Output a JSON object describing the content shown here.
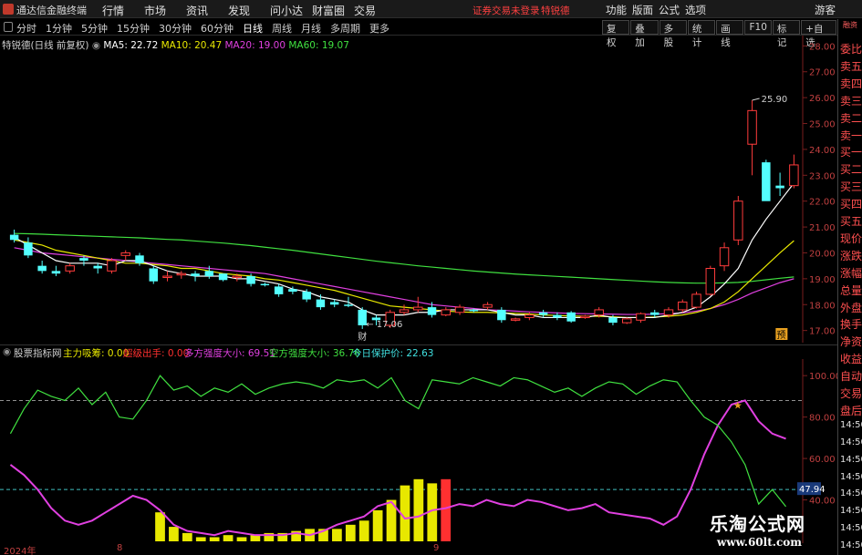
{
  "app": {
    "title": "通达信金融终端",
    "menu": [
      "行情",
      "市场",
      "资讯",
      "发现",
      "问小达",
      "财富圈",
      "交易"
    ],
    "alert": "证券交易未登录",
    "alert_stock": "特锐德",
    "right_menu": [
      "功能",
      "版面",
      "公式",
      "选项"
    ],
    "guest": "游客"
  },
  "toolbar": {
    "periods": [
      "分时",
      "1分钟",
      "5分钟",
      "15分钟",
      "30分钟",
      "60分钟",
      "日线",
      "周线",
      "月线",
      "多周期",
      "更多"
    ],
    "active_period": "日线",
    "right_tools": [
      "复权",
      "叠加",
      "多股",
      "统计",
      "画线",
      "F10",
      "标记",
      "+自选"
    ]
  },
  "chart_header": {
    "stock_name": "特锐德(日线 前复权)",
    "ma5": "MA5: 22.72",
    "ma10": "MA10: 20.47",
    "ma20": "MA20: 19.00",
    "ma60": "MA60: 19.07",
    "ma5_color": "#ffffff",
    "ma10_color": "#e8e800",
    "ma20_color": "#e040e0",
    "ma60_color": "#40e040"
  },
  "indicator_header": {
    "name": "股票指标网",
    "items": [
      {
        "text": "主力吸筹: 0.00",
        "color": "#e8e800"
      },
      {
        "text": "超级出手: 0.00",
        "color": "#ff3030"
      },
      {
        "text": "多方强度大小: 69.51",
        "color": "#e040e0"
      },
      {
        "text": "空方强度大小: 36.76",
        "color": "#40e040"
      },
      {
        "text": "今日保护价: 22.63",
        "color": "#40e0e0"
      }
    ]
  },
  "side_panel": {
    "top_label": "融资",
    "labels": [
      "委比",
      "卖五",
      "卖四",
      "卖三",
      "卖二",
      "卖一",
      "买一",
      "买二",
      "买三",
      "买四",
      "买五",
      "现价",
      "涨跌",
      "涨幅",
      "总量",
      "外盘",
      "换手",
      "净资",
      "收益",
      "自动",
      "交易",
      "盘后",
      "14:50",
      "14:50",
      "14:50",
      "14:50",
      "14:50",
      "14:50",
      "14:50",
      "14:50"
    ]
  },
  "annotations": {
    "high_label": "25.90",
    "low_label": "17.06",
    "low_marker": "财",
    "pre_marker": "预",
    "sub_value_tag": "47.94"
  },
  "x_axis": {
    "labels": [
      "2024年",
      "8",
      "9"
    ]
  },
  "watermark": {
    "line1": "乐淘公式网",
    "line2": "www.60lt.com"
  },
  "chart_data": [
    {
      "type": "candlestick",
      "title": "特锐德(日线 前复权)",
      "ylim": [
        16.6,
        28.4
      ],
      "y_ticks": [
        28.0,
        27.0,
        26.0,
        25.0,
        24.0,
        23.0,
        22.0,
        21.0,
        20.0,
        19.0,
        18.0,
        17.0
      ],
      "candles": [
        {
          "o": 20.7,
          "h": 20.9,
          "l": 20.4,
          "c": 20.5
        },
        {
          "o": 20.4,
          "h": 20.6,
          "l": 19.8,
          "c": 19.9
        },
        {
          "o": 19.5,
          "h": 19.7,
          "l": 19.2,
          "c": 19.3
        },
        {
          "o": 19.3,
          "h": 19.5,
          "l": 19.1,
          "c": 19.2
        },
        {
          "o": 19.3,
          "h": 19.6,
          "l": 19.2,
          "c": 19.5
        },
        {
          "o": 19.8,
          "h": 19.9,
          "l": 19.5,
          "c": 19.7
        },
        {
          "o": 19.5,
          "h": 19.6,
          "l": 19.2,
          "c": 19.4
        },
        {
          "o": 19.3,
          "h": 19.8,
          "l": 19.2,
          "c": 19.7
        },
        {
          "o": 19.9,
          "h": 20.1,
          "l": 19.7,
          "c": 20.0
        },
        {
          "o": 19.9,
          "h": 20.0,
          "l": 19.5,
          "c": 19.6
        },
        {
          "o": 19.4,
          "h": 19.5,
          "l": 18.8,
          "c": 18.9
        },
        {
          "o": 19.1,
          "h": 19.3,
          "l": 18.9,
          "c": 19.1
        },
        {
          "o": 19.2,
          "h": 19.3,
          "l": 19.0,
          "c": 19.2
        },
        {
          "o": 19.2,
          "h": 19.3,
          "l": 18.9,
          "c": 19.1
        },
        {
          "o": 19.3,
          "h": 19.5,
          "l": 19.0,
          "c": 19.1
        },
        {
          "o": 19.2,
          "h": 19.2,
          "l": 18.9,
          "c": 18.95
        },
        {
          "o": 19.05,
          "h": 19.2,
          "l": 18.9,
          "c": 19.1
        },
        {
          "o": 19.1,
          "h": 19.2,
          "l": 18.7,
          "c": 18.8
        },
        {
          "o": 18.8,
          "h": 18.85,
          "l": 18.7,
          "c": 18.75
        },
        {
          "o": 18.7,
          "h": 18.8,
          "l": 18.3,
          "c": 18.4
        },
        {
          "o": 18.6,
          "h": 18.7,
          "l": 18.4,
          "c": 18.5
        },
        {
          "o": 18.5,
          "h": 18.6,
          "l": 18.1,
          "c": 18.2
        },
        {
          "o": 18.2,
          "h": 18.4,
          "l": 17.8,
          "c": 17.9
        },
        {
          "o": 18.1,
          "h": 18.2,
          "l": 17.9,
          "c": 18.0
        },
        {
          "o": 18.0,
          "h": 18.3,
          "l": 17.9,
          "c": 17.95
        },
        {
          "o": 17.8,
          "h": 17.9,
          "l": 17.06,
          "c": 17.2
        },
        {
          "o": 17.5,
          "h": 17.6,
          "l": 17.2,
          "c": 17.4
        },
        {
          "o": 17.2,
          "h": 17.8,
          "l": 17.1,
          "c": 17.7
        },
        {
          "o": 17.7,
          "h": 18.0,
          "l": 17.6,
          "c": 17.8
        },
        {
          "o": 17.8,
          "h": 18.3,
          "l": 17.7,
          "c": 17.9
        },
        {
          "o": 17.9,
          "h": 18.1,
          "l": 17.5,
          "c": 17.6
        },
        {
          "o": 17.6,
          "h": 17.9,
          "l": 17.55,
          "c": 17.8
        },
        {
          "o": 17.7,
          "h": 18.0,
          "l": 17.6,
          "c": 17.9
        },
        {
          "o": 17.8,
          "h": 17.85,
          "l": 17.7,
          "c": 17.75
        },
        {
          "o": 17.9,
          "h": 18.1,
          "l": 17.8,
          "c": 18.0
        },
        {
          "o": 17.8,
          "h": 17.9,
          "l": 17.3,
          "c": 17.4
        },
        {
          "o": 17.4,
          "h": 17.5,
          "l": 17.35,
          "c": 17.45
        },
        {
          "o": 17.5,
          "h": 17.7,
          "l": 17.4,
          "c": 17.6
        },
        {
          "o": 17.7,
          "h": 17.8,
          "l": 17.5,
          "c": 17.6
        },
        {
          "o": 17.6,
          "h": 17.7,
          "l": 17.4,
          "c": 17.5
        },
        {
          "o": 17.7,
          "h": 17.75,
          "l": 17.3,
          "c": 17.35
        },
        {
          "o": 17.5,
          "h": 17.6,
          "l": 17.45,
          "c": 17.55
        },
        {
          "o": 17.6,
          "h": 17.9,
          "l": 17.5,
          "c": 17.8
        },
        {
          "o": 17.5,
          "h": 17.6,
          "l": 17.2,
          "c": 17.3
        },
        {
          "o": 17.3,
          "h": 17.5,
          "l": 17.25,
          "c": 17.45
        },
        {
          "o": 17.4,
          "h": 17.7,
          "l": 17.3,
          "c": 17.65
        },
        {
          "o": 17.7,
          "h": 17.8,
          "l": 17.5,
          "c": 17.6
        },
        {
          "o": 17.6,
          "h": 17.9,
          "l": 17.5,
          "c": 17.8
        },
        {
          "o": 17.8,
          "h": 18.2,
          "l": 17.7,
          "c": 18.1
        },
        {
          "o": 17.9,
          "h": 18.5,
          "l": 17.85,
          "c": 18.4
        },
        {
          "o": 18.4,
          "h": 19.5,
          "l": 18.35,
          "c": 19.4
        },
        {
          "o": 19.5,
          "h": 20.4,
          "l": 19.3,
          "c": 20.2
        },
        {
          "o": 20.5,
          "h": 22.2,
          "l": 20.3,
          "c": 22.0
        },
        {
          "o": 24.2,
          "h": 25.9,
          "l": 23.0,
          "c": 25.5
        },
        {
          "o": 23.5,
          "h": 23.6,
          "l": 22.5,
          "c": 22.0
        },
        {
          "o": 22.6,
          "h": 23.1,
          "l": 22.2,
          "c": 22.5
        },
        {
          "o": 22.6,
          "h": 23.8,
          "l": 22.5,
          "c": 23.4
        }
      ],
      "ma5": [
        20.6,
        20.3,
        20.0,
        19.7,
        19.6,
        19.6,
        19.6,
        19.5,
        19.7,
        19.7,
        19.5,
        19.3,
        19.2,
        19.1,
        19.1,
        19.1,
        19.0,
        19.0,
        18.9,
        18.8,
        18.6,
        18.5,
        18.3,
        18.2,
        18.1,
        17.8,
        17.6,
        17.6,
        17.6,
        17.7,
        17.7,
        17.8,
        17.8,
        17.8,
        17.8,
        17.7,
        17.6,
        17.6,
        17.5,
        17.5,
        17.5,
        17.5,
        17.6,
        17.5,
        17.5,
        17.5,
        17.5,
        17.6,
        17.7,
        17.9,
        18.3,
        18.8,
        19.4,
        20.5,
        21.3,
        22.0,
        22.7
      ],
      "ma10": [
        20.5,
        20.4,
        20.3,
        20.1,
        20.0,
        19.9,
        19.8,
        19.7,
        19.6,
        19.6,
        19.55,
        19.5,
        19.4,
        19.4,
        19.3,
        19.2,
        19.15,
        19.1,
        19.0,
        18.95,
        18.85,
        18.75,
        18.65,
        18.55,
        18.4,
        18.25,
        18.1,
        17.95,
        17.9,
        17.85,
        17.8,
        17.75,
        17.72,
        17.7,
        17.7,
        17.68,
        17.66,
        17.64,
        17.6,
        17.58,
        17.56,
        17.55,
        17.55,
        17.53,
        17.5,
        17.5,
        17.52,
        17.55,
        17.6,
        17.7,
        17.85,
        18.1,
        18.5,
        19.0,
        19.5,
        20.0,
        20.47
      ],
      "ma20": [
        20.2,
        20.1,
        20.0,
        19.95,
        19.9,
        19.85,
        19.8,
        19.75,
        19.7,
        19.65,
        19.6,
        19.55,
        19.5,
        19.45,
        19.4,
        19.35,
        19.3,
        19.25,
        19.2,
        19.1,
        19.0,
        18.9,
        18.8,
        18.7,
        18.6,
        18.5,
        18.4,
        18.3,
        18.2,
        18.1,
        18.0,
        17.95,
        17.9,
        17.85,
        17.8,
        17.78,
        17.75,
        17.72,
        17.7,
        17.68,
        17.66,
        17.65,
        17.64,
        17.63,
        17.62,
        17.62,
        17.63,
        17.65,
        17.68,
        17.75,
        17.85,
        18.0,
        18.2,
        18.45,
        18.65,
        18.85,
        19.0
      ],
      "ma60": [
        20.75,
        20.74,
        20.72,
        20.7,
        20.68,
        20.66,
        20.64,
        20.62,
        20.6,
        20.58,
        20.55,
        20.52,
        20.5,
        20.46,
        20.42,
        20.38,
        20.33,
        20.28,
        20.22,
        20.16,
        20.1,
        20.03,
        19.96,
        19.89,
        19.82,
        19.75,
        19.68,
        19.62,
        19.56,
        19.5,
        19.45,
        19.4,
        19.35,
        19.3,
        19.26,
        19.22,
        19.18,
        19.15,
        19.12,
        19.09,
        19.06,
        19.03,
        19.0,
        18.97,
        18.94,
        18.91,
        18.88,
        18.86,
        18.84,
        18.83,
        18.83,
        18.84,
        18.86,
        18.9,
        18.96,
        19.02,
        19.07
      ]
    },
    {
      "type": "line",
      "title": "股票指标网",
      "ylim": [
        20,
        108
      ],
      "y_ticks": [
        100.0,
        80.0,
        60.0,
        40.0
      ],
      "series": [
        {
          "name": "多方强度大小",
          "color": "#e040e0",
          "values": [
            57,
            52,
            45,
            36,
            30,
            28,
            30,
            34,
            38,
            42,
            40,
            35,
            28,
            25,
            24,
            23,
            25,
            24,
            23,
            23,
            23,
            24,
            23,
            25,
            28,
            30,
            32,
            37,
            39,
            31,
            32,
            35,
            36,
            38,
            37,
            40,
            38,
            37,
            40,
            39,
            37,
            35,
            36,
            38,
            34,
            33,
            32,
            31,
            28,
            32,
            45,
            62,
            76,
            86,
            88,
            78,
            72,
            69.51
          ]
        },
        {
          "name": "空方强度大小",
          "color": "#40e040",
          "values": [
            72,
            84,
            93,
            90,
            88,
            94,
            86,
            92,
            80,
            79,
            88,
            100,
            93,
            95,
            90,
            94,
            92,
            96,
            91,
            94,
            96,
            97,
            96,
            94,
            98,
            97,
            98,
            94,
            99,
            88,
            84,
            98,
            97,
            96,
            99,
            97,
            95,
            99,
            98,
            95,
            92,
            94,
            90,
            94,
            97,
            96,
            91,
            95,
            98,
            97,
            88,
            80,
            76,
            68,
            57,
            38,
            45,
            36.76
          ]
        },
        {
          "name": "主力吸筹",
          "color": "#e8e800",
          "bars": [
            0,
            0,
            0,
            0,
            0,
            0,
            0,
            0,
            0,
            0,
            0,
            34,
            27,
            24,
            22,
            22,
            23,
            22,
            23,
            24,
            24,
            25,
            26,
            26,
            26,
            28,
            30,
            35,
            40,
            47,
            50,
            48,
            0,
            0,
            0,
            0,
            0,
            0,
            0,
            0,
            0,
            0,
            0,
            0,
            0,
            0,
            0,
            0,
            0,
            0,
            0,
            0,
            0,
            0,
            0,
            0,
            0,
            0
          ]
        },
        {
          "name": "超级出手",
          "color": "#ff3030",
          "bars": [
            0,
            0,
            0,
            0,
            0,
            0,
            0,
            0,
            0,
            0,
            0,
            0,
            0,
            0,
            0,
            0,
            0,
            0,
            0,
            0,
            0,
            0,
            0,
            0,
            0,
            0,
            0,
            0,
            0,
            0,
            0,
            0,
            50,
            0,
            0,
            0,
            0,
            0,
            0,
            0,
            0,
            0,
            0,
            0,
            0,
            0,
            0,
            0,
            0,
            0,
            0,
            0,
            0,
            0,
            0,
            0,
            0,
            0
          ]
        }
      ],
      "reference_lines": [
        {
          "value": 88,
          "color": "#909090"
        },
        {
          "value": 45,
          "color": "#40c0c0"
        }
      ]
    }
  ]
}
